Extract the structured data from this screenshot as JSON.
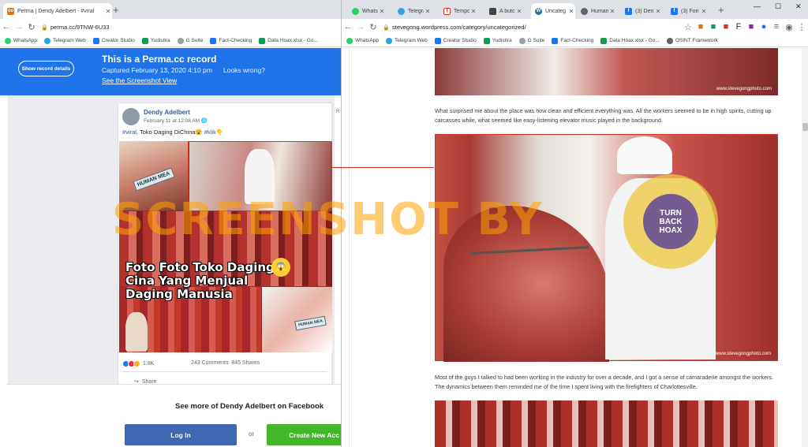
{
  "left_window": {
    "tab": {
      "title": "Perma | Dendy Adelbert - #viral",
      "favicon": "perma-icon"
    },
    "url": "perma.cc/9TNW-6U33",
    "bookmarks": [
      "WhatsApp",
      "Telegram Web",
      "Creator Studio",
      "Yudistira",
      "G Suite",
      "Fact-Checking",
      "Data Hoax.xlsx - Go..."
    ]
  },
  "perma": {
    "show_record": "Show record details",
    "title": "This is a Perma.cc record",
    "captured": "Captured February 13, 2020 4:10 pm",
    "wrong": "Looks wrong?",
    "screenshot_link": "See the Screenshot View"
  },
  "fb_post": {
    "author": "Dendy Adelbert",
    "date": "February 11 at 12:08 AM",
    "text_tag1": "#viral",
    "text_body": ", Toko Daging DiChina😮 ",
    "text_tag2": "#klik",
    "text_end": "👇",
    "image_caption": "Foto Foto Toko Daging Cina Yang Menjual Daging Manusia",
    "label_human": "HUMAN MEA",
    "reactions": "1.8K",
    "comments": "243 Comments",
    "shares": "845 Shares",
    "share_label": "Share"
  },
  "right_edge_letter": "R",
  "fb_footer": {
    "see_more": "See more of Dendy Adelbert on Facebook",
    "login": "Log In",
    "or": "or",
    "create": "Create New Acc"
  },
  "right_window": {
    "tabs": [
      {
        "title": "WhatsApp",
        "color": "#25d366"
      },
      {
        "title": "Telegram",
        "color": "#2ca5e0"
      },
      {
        "title": "Tempo",
        "color": "#d93025"
      },
      {
        "title": "A butch",
        "color": "#444444"
      },
      {
        "title": "Uncateg",
        "color": "#21759b",
        "active": true
      },
      {
        "title": "Human",
        "color": "#5f6368"
      },
      {
        "title": "(3) Den",
        "color": "#1877f2"
      },
      {
        "title": "(3) Fon",
        "color": "#1877f2"
      }
    ],
    "url": "stevegong.wordpress.com/category/uncategorized/",
    "bookmarks": [
      "WhatsApp",
      "Telegram Web",
      "Creator Studio",
      "Yudistira",
      "G Suite",
      "Fact-Checking",
      "Data Hoax.xlsx - Go...",
      "OSINT Framework"
    ]
  },
  "blog": {
    "watermark": "www.stevegongphoto.com",
    "para1": "What surprised me about the place was how clean and efficient everything was.  All the workers seemed to be in high spirits, cutting up carcasses while, what seemed like easy-listening elevator music played in the background.",
    "para2": "Most of the guys I talked to had been working in the industry for over a decade, and I got a sense of camaraderie amongst the workers.  The dynamics between them reminded me of the time I spent living with the firefighters of Charlottesville.",
    "badge_line1": "TURN",
    "badge_line2": "BACK",
    "badge_line3": "HOAX"
  },
  "overlay": {
    "watermark": "SCREENSHOT BY"
  },
  "colors": {
    "perma_blue": "#1e74e8",
    "fb_blue": "#4267b2",
    "fb_green": "#42b72a",
    "highlight_red": "#d93025",
    "watermark_orange": "#ffa300"
  }
}
